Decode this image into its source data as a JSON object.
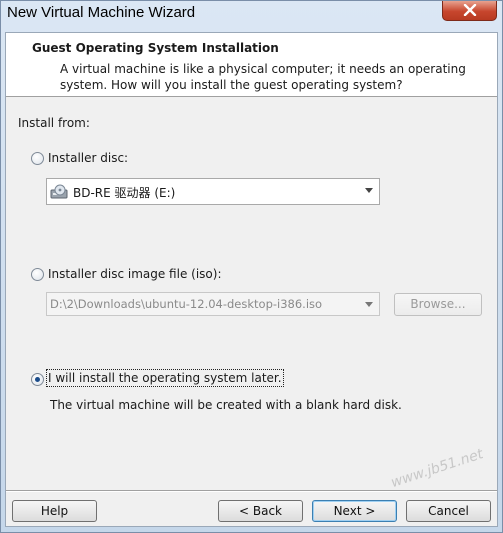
{
  "window": {
    "title": "New Virtual Machine Wizard"
  },
  "header": {
    "title": "Guest Operating System Installation",
    "description": "A virtual machine is like a physical computer; it needs an operating system. How will you install the guest operating system?"
  },
  "install_from": {
    "label": "Install from:",
    "option_disc": {
      "label": "Installer disc:",
      "checked": false
    },
    "disc_select": {
      "value": "BD-RE 驱动器 (E:)"
    },
    "option_iso": {
      "label": "Installer disc image file (iso):",
      "checked": false
    },
    "iso_select": {
      "value": "D:\\2\\Downloads\\ubuntu-12.04-desktop-i386.iso"
    },
    "browse_label": "Browse...",
    "option_later": {
      "label": "I will install the operating system later.",
      "checked": true
    },
    "later_note": "The virtual machine will be created with a blank hard disk."
  },
  "footer": {
    "help_label": "Help",
    "back_label": "< Back",
    "next_label": "Next >",
    "cancel_label": "Cancel"
  },
  "watermark": "www.jb51.net"
}
